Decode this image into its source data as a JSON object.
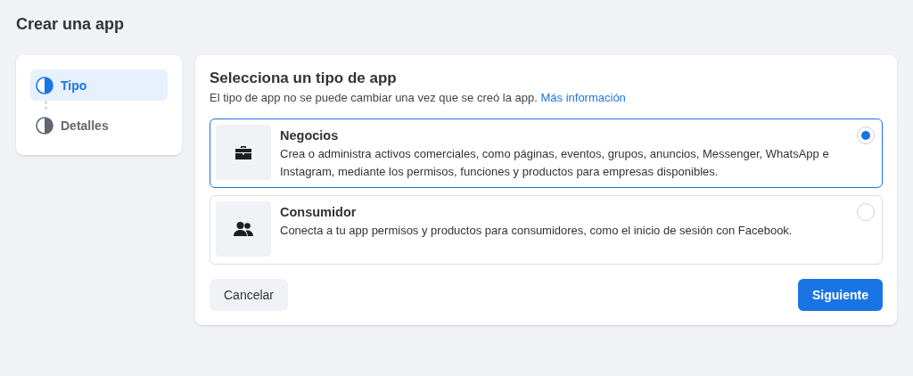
{
  "page_title": "Crear una app",
  "steps": [
    {
      "label": "Tipo",
      "selected": true
    },
    {
      "label": "Detalles",
      "selected": false
    }
  ],
  "heading": "Selecciona un tipo de app",
  "subtitle": "El tipo de app no se puede cambiar una vez que se creó la app.",
  "link": "Más información",
  "options": [
    {
      "kind": "briefcase",
      "title": "Negocios",
      "description": "Crea o administra activos comerciales, como páginas, eventos, grupos, anuncios, Messenger, WhatsApp e Instagram, mediante los permisos, funciones y productos para empresas disponibles.",
      "selected": true
    },
    {
      "kind": "people",
      "title": "Consumidor",
      "description": "Conecta a tu app permisos y productos para consumidores, como el inicio de sesión con Facebook.",
      "selected": false
    }
  ],
  "cancel": "Cancelar",
  "next": "Siguiente"
}
